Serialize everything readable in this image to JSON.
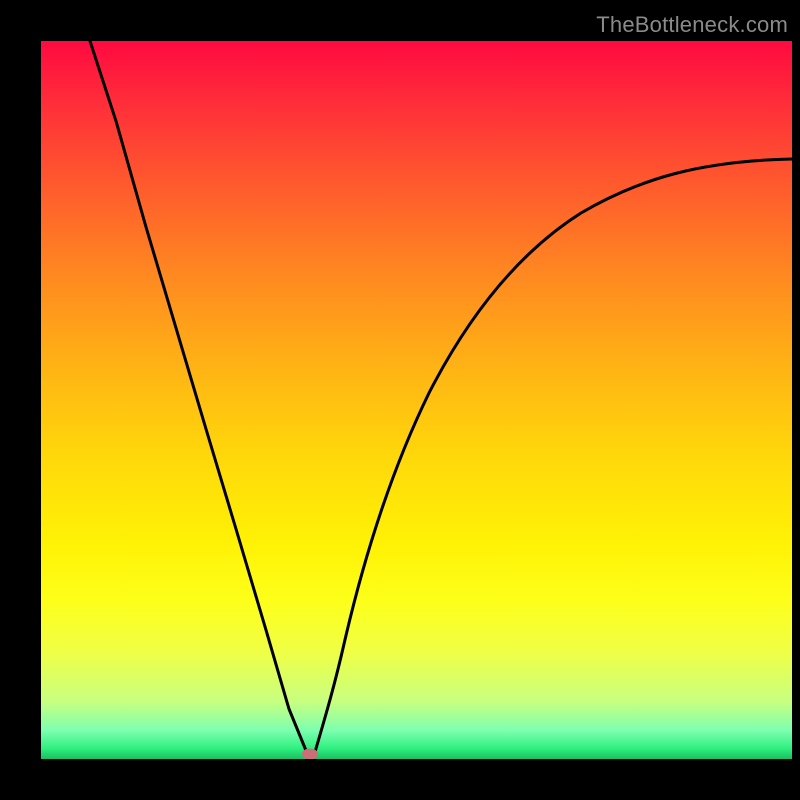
{
  "watermark": "TheBottleneck.com",
  "chart_data": {
    "type": "line",
    "title": "",
    "xlabel": "",
    "ylabel": "",
    "xlim": [
      0,
      100
    ],
    "ylim": [
      0,
      100
    ],
    "series": [
      {
        "name": "curve-left",
        "x": [
          7,
          10,
          14,
          18,
          22,
          26,
          30,
          33,
          35.5
        ],
        "values": [
          99,
          88,
          74,
          60,
          46,
          32,
          18,
          7,
          0.5
        ]
      },
      {
        "name": "curve-right",
        "x": [
          36.5,
          39,
          43,
          48,
          54,
          62,
          72,
          84,
          100
        ],
        "values": [
          1,
          10,
          24,
          39,
          52,
          63,
          72,
          78.5,
          83
        ]
      }
    ],
    "marker": {
      "x": 35.8,
      "y": 0.6,
      "color": "#cc6e77"
    },
    "gradient": {
      "top": "#ff0a40",
      "mid": "#ffe000",
      "bottom": "#18c060"
    }
  }
}
